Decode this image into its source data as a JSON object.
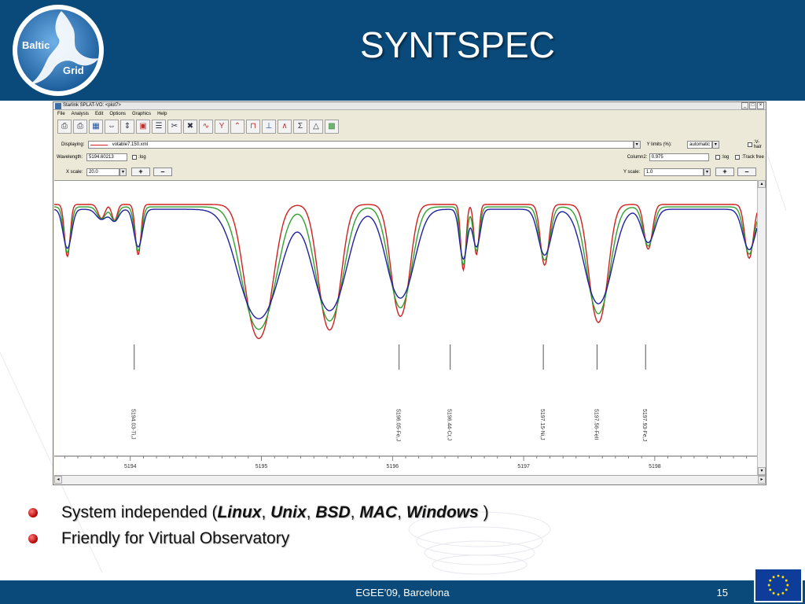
{
  "slide": {
    "title": "SYNTSPEC",
    "logo_line1": "Baltic",
    "logo_line2": "Grid"
  },
  "app": {
    "window_title": "Starlink SPLAT-VO: <plot7>",
    "menu": [
      "File",
      "Analysis",
      "Edit",
      "Options",
      "Graphics",
      "Help"
    ],
    "toolbar_icons": [
      "print-icon",
      "print-color-icon",
      "zoom-icon",
      "fit-width-icon",
      "fit-height-icon",
      "spectrum-icon",
      "list-icon",
      "cut-icon",
      "delete-icon",
      "line-icon",
      "fork-icon",
      "peak-icon",
      "flux-icon",
      "baseline-icon",
      "overlay-icon",
      "sum-icon",
      "triangle-icon",
      "grid-icon"
    ],
    "displaying_label": "Displaying:",
    "displaying_value": "votable7.150.xml",
    "ylimits_label": "Y limits (%):",
    "ylimits_value": "automatic",
    "vhair_label": ":V-hair",
    "wavelength_label": "Wavelength:",
    "wavelength_value": "5194.60213",
    "log_label": ":log",
    "column2_label": "Column2:",
    "column2_value": "0.975",
    "log2_label": ":log",
    "trackfree_label": ":Track free",
    "xscale_label": "X scale:",
    "xscale_value": "20.0",
    "yscale_label": "Y scale:",
    "yscale_value": "1.0",
    "plus_label": "+",
    "minus_label": "–"
  },
  "chart_data": {
    "type": "line",
    "xlim": [
      5193.42,
      5198.78
    ],
    "ylim": [
      0,
      1.0
    ],
    "x_ticks": [
      5194,
      5195,
      5196,
      5197,
      5198
    ],
    "series_colors": [
      "#d02020",
      "#30a030",
      "#2020a0"
    ],
    "line_markers": [
      {
        "x": 5194.03,
        "label": "5194.03-Ti,J"
      },
      {
        "x": 5196.05,
        "label": "5196.05-Fe,J"
      },
      {
        "x": 5196.44,
        "label": "5196.44-Cr,J"
      },
      {
        "x": 5197.15,
        "label": "5197.15-Ni,J"
      },
      {
        "x": 5197.56,
        "label": "5197.56-FeII"
      },
      {
        "x": 5197.93,
        "label": "5197.93-Fe,J"
      }
    ]
  },
  "bullets": {
    "b1_prefix": "System independed (",
    "b1_linux": "Linux",
    "b1_sep1": ", ",
    "b1_unix": "Unix",
    "b1_sep2": ", ",
    "b1_bsd": "BSD",
    "b1_sep3": ", ",
    "b1_mac": "MAC",
    "b1_sep4": ", ",
    "b1_windows": "Windows",
    "b1_suffix": " )",
    "b2": "Friendly for Virtual Observatory"
  },
  "footer": {
    "center": "EGEE’09, Barcelona",
    "page": "15"
  }
}
